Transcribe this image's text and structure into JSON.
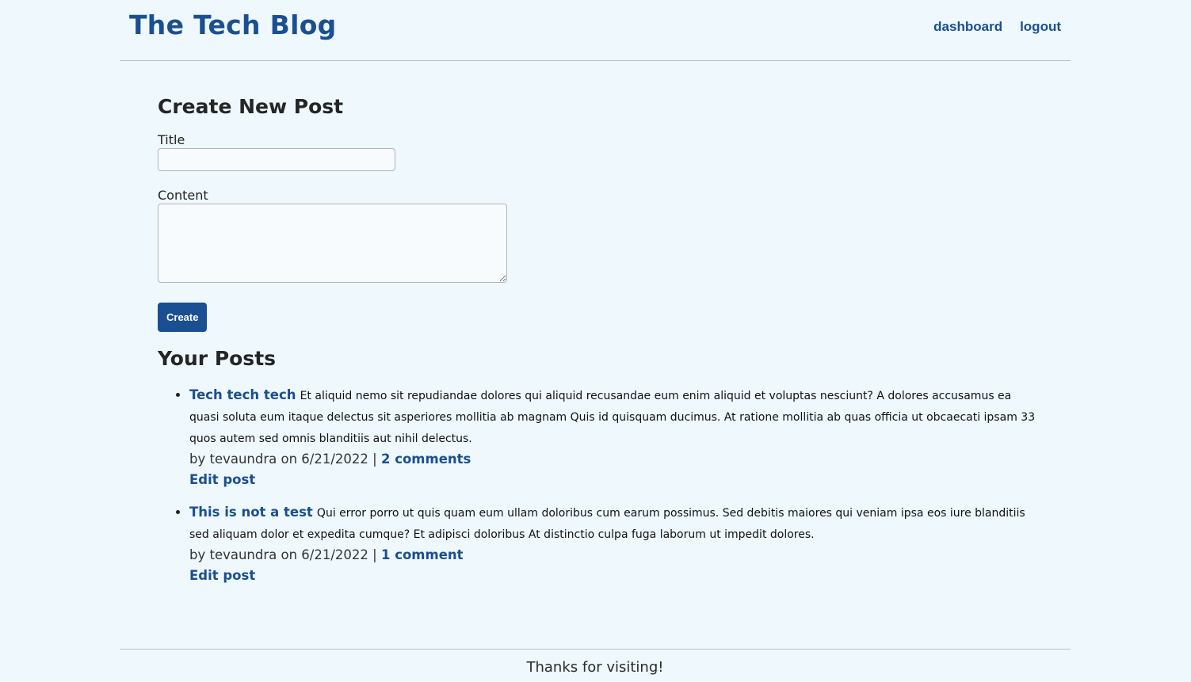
{
  "header": {
    "site_title": "The Tech Blog",
    "nav": [
      {
        "label": "dashboard"
      },
      {
        "label": "logout"
      }
    ]
  },
  "create_post": {
    "heading": "Create New Post",
    "title_label": "Title",
    "title_value": "",
    "content_label": "Content",
    "content_value": "",
    "submit_label": "Create"
  },
  "your_posts": {
    "heading": "Your Posts",
    "posts": [
      {
        "title": "Tech tech tech",
        "body": "Et aliquid nemo sit repudiandae dolores qui aliquid recusandae eum enim aliquid et voluptas nesciunt? A dolores accusamus ea quasi soluta eum itaque delectus sit asperiores mollitia ab magnam Quis id quisquam ducimus. At ratione mollitia ab quas officia ut obcaecati ipsam 33 quos autem sed omnis blanditiis aut nihil delectus.",
        "meta_prefix": "by tevaundra on 6/21/2022 | ",
        "comments_label": "2 comments",
        "edit_label": "Edit post"
      },
      {
        "title": "This is not a test",
        "body": "Qui error porro ut quis quam eum ullam doloribus cum earum possimus. Sed debitis maiores qui veniam ipsa eos iure blanditiis sed aliquam dolor et expedita cumque? Et adipisci doloribus At distinctio culpa fuga laborum ut impedit dolores.",
        "meta_prefix": "by tevaundra on 6/21/2022 | ",
        "comments_label": "1 comment",
        "edit_label": "Edit post"
      }
    ]
  },
  "footer": {
    "text": "Thanks for visiting!"
  },
  "colors": {
    "background": "#eef8fd",
    "accent": "#1a4f91",
    "divider": "#b9bfc4"
  }
}
